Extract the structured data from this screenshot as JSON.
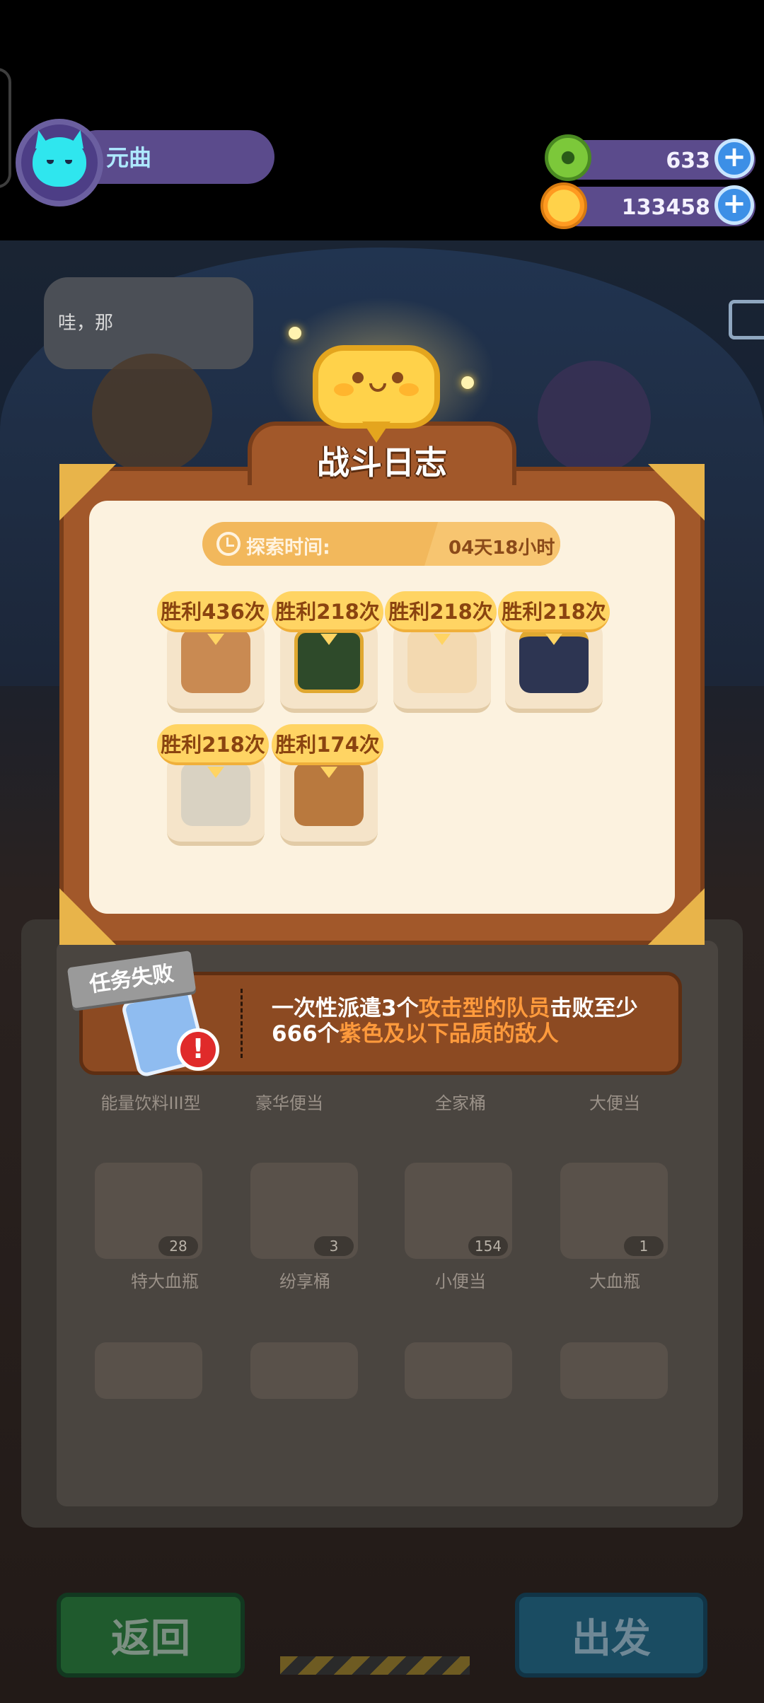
{
  "player": {
    "name": "元曲"
  },
  "currencies": [
    {
      "name": "gem",
      "icon": "green-donut-icon",
      "value": "633",
      "color": "#7cc83a"
    },
    {
      "name": "coin",
      "icon": "planet-coin-icon",
      "value": "133458",
      "color": "#ffb020"
    }
  ],
  "background": {
    "speech_text": "哇，那",
    "items_row1_labels": [
      "能量饮料III型",
      "豪华便当",
      "全家桶",
      "大便当"
    ],
    "items_row2": [
      {
        "label": "特大血瓶",
        "count": "28"
      },
      {
        "label": "纷享桶",
        "count": "3"
      },
      {
        "label": "小便当",
        "count": "154"
      },
      {
        "label": "大血瓶",
        "count": "1"
      }
    ],
    "back_button": "返回",
    "depart_button": "出发"
  },
  "battle_log": {
    "title": "战斗日志",
    "explore_label": "探索时间:",
    "explore_value": "04天18小时",
    "enemies": [
      {
        "icon": "calico-cat-detective-icon",
        "victories": "胜利436次",
        "color": "#c98a52"
      },
      {
        "icon": "221b-sign-monster-icon",
        "victories": "胜利218次",
        "color": "#2e4a2a"
      },
      {
        "icon": "wafer-block-monster-icon",
        "victories": "胜利218次",
        "color": "#f3d9b0"
      },
      {
        "icon": "drum-monster-icon",
        "victories": "胜利218次",
        "color": "#2d3552"
      },
      {
        "icon": "twin-birds-icon",
        "victories": "胜利218次",
        "color": "#d9d2c2"
      },
      {
        "icon": "treasure-crate-monster-icon",
        "victories": "胜利174次",
        "color": "#b9793e"
      }
    ]
  },
  "mission": {
    "status_tag": "任务失败",
    "text_parts": [
      {
        "text": "一次性派遣3个",
        "highlight": false
      },
      {
        "text": "攻击型的队员",
        "highlight": true
      },
      {
        "text": "击败至少666个",
        "highlight": false
      },
      {
        "text": "紫色及以下品质的敌人",
        "highlight": true
      }
    ]
  }
}
